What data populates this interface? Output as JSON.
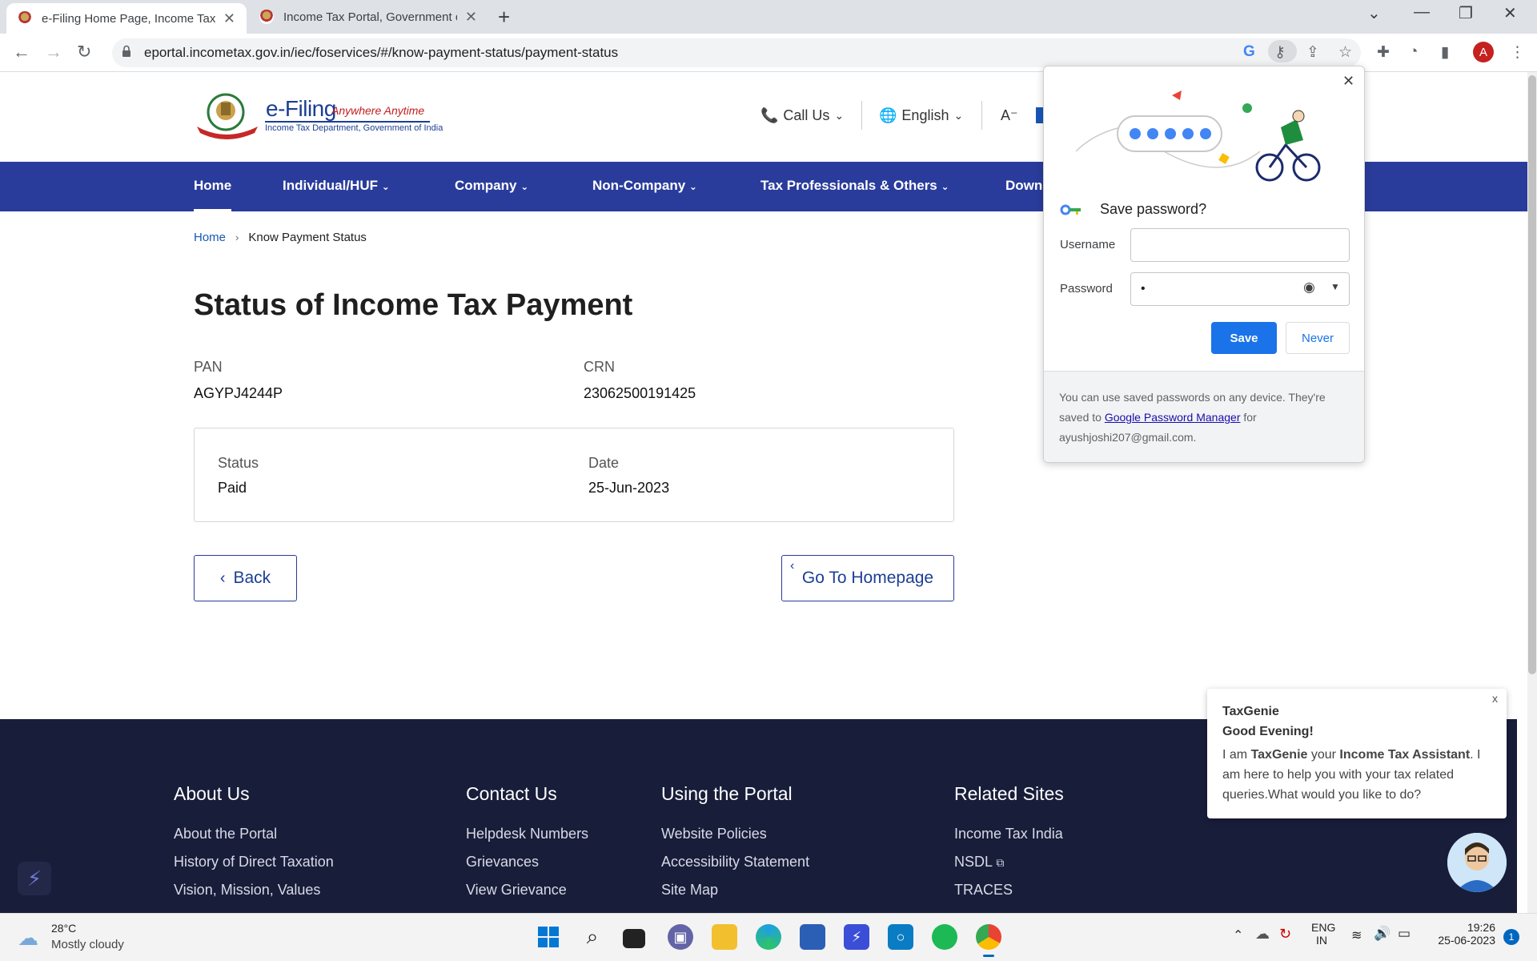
{
  "browser": {
    "tabs": [
      {
        "title": "e-Filing Home Page, Income Tax De"
      },
      {
        "title": "Income Tax Portal, Government of"
      }
    ],
    "url": "eportal.incometax.gov.in/iec/foservices/#/know-payment-status/payment-status",
    "avatar_letter": "A"
  },
  "site": {
    "brand": "e-Filing",
    "tagline": "Anywhere Anytime",
    "subtitle": "Income Tax Department, Government of India",
    "call_us": "Call Us",
    "language": "English",
    "font_resize": "A⁻"
  },
  "nav": {
    "items": [
      "Home",
      "Individual/HUF",
      "Company",
      "Non-Company",
      "Tax Professionals & Others",
      "Downl"
    ]
  },
  "breadcrumb": {
    "home": "Home",
    "current": "Know Payment Status"
  },
  "page": {
    "title": "Status of Income Tax Payment",
    "pan_label": "PAN",
    "pan_value": "AGYPJ4244P",
    "crn_label": "CRN",
    "crn_value": "23062500191425",
    "status_label": "Status",
    "status_value": "Paid",
    "date_label": "Date",
    "date_value": "25-Jun-2023",
    "back_label": "Back",
    "home_label": "Go To Homepage"
  },
  "password_popup": {
    "title": "Save password?",
    "username_label": "Username",
    "username_value": "",
    "password_label": "Password",
    "password_value": "•",
    "save_label": "Save",
    "never_label": "Never",
    "info_prefix": "You can use saved passwords on any device. They're saved to ",
    "info_link": "Google Password Manager",
    "info_suffix": " for",
    "info_email": "ayushjoshi207@gmail.com."
  },
  "footer": {
    "columns": [
      {
        "heading": "About Us",
        "links": [
          "About the Portal",
          "History of Direct Taxation",
          "Vision, Mission, Values"
        ]
      },
      {
        "heading": "Contact Us",
        "links": [
          "Helpdesk Numbers",
          "Grievances",
          "View Grievance"
        ]
      },
      {
        "heading": "Using the Portal",
        "links": [
          "Website Policies",
          "Accessibility Statement",
          "Site Map"
        ]
      },
      {
        "heading": "Related Sites",
        "links": [
          "Income Tax India",
          "NSDL",
          "TRACES"
        ]
      }
    ]
  },
  "chatbot": {
    "close": "x",
    "name": "TaxGenie",
    "greeting": "Good Evening!",
    "msg_1": "I am ",
    "msg_name": "TaxGenie",
    "msg_2": " your ",
    "msg_role": "Income Tax Assistant",
    "msg_3": ". I am here to help you with your tax related queries.What would you like to do?"
  },
  "taskbar": {
    "temperature": "28°C",
    "weather": "Mostly cloudy",
    "lang_1": "ENG",
    "lang_2": "IN",
    "time": "19:26",
    "date": "25-06-2023",
    "notifications": "1"
  }
}
